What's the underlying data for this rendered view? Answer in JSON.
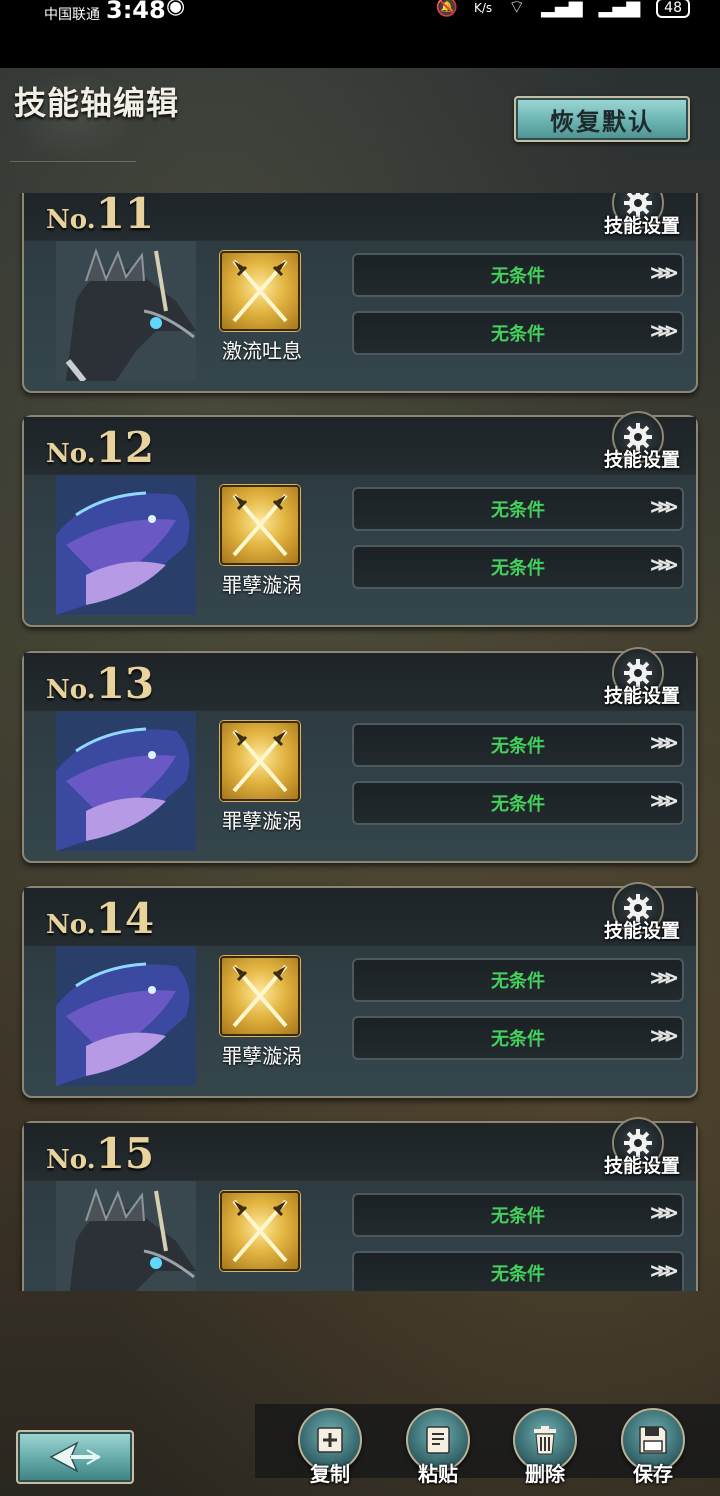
{
  "status_bar": {
    "carrier": "中国联通",
    "time": "3:48",
    "speed_unit": "K/s",
    "battery": "48"
  },
  "header": {
    "title": "技能轴编辑",
    "restore_label": "恢复默认"
  },
  "cards": [
    {
      "no_prefix": "No.",
      "number": "11",
      "settings_label": "技能设置",
      "skill_name": "激流吐息",
      "portrait": "dragon",
      "conditions": [
        "无条件",
        "无条件"
      ]
    },
    {
      "no_prefix": "No.",
      "number": "12",
      "settings_label": "技能设置",
      "skill_name": "罪孽漩涡",
      "portrait": "whale",
      "conditions": [
        "无条件",
        "无条件"
      ]
    },
    {
      "no_prefix": "No.",
      "number": "13",
      "settings_label": "技能设置",
      "skill_name": "罪孽漩涡",
      "portrait": "whale",
      "conditions": [
        "无条件",
        "无条件"
      ]
    },
    {
      "no_prefix": "No.",
      "number": "14",
      "settings_label": "技能设置",
      "skill_name": "罪孽漩涡",
      "portrait": "whale",
      "conditions": [
        "无条件",
        "无条件"
      ]
    },
    {
      "no_prefix": "No.",
      "number": "15",
      "settings_label": "技能设置",
      "skill_name": "",
      "portrait": "dragon",
      "conditions": [
        "无条件",
        "无条件"
      ]
    }
  ],
  "bottom_bar": {
    "copy_label": "复制",
    "paste_label": "粘贴",
    "delete_label": "删除",
    "save_label": "保存"
  },
  "colors": {
    "condition_text": "#44d05c",
    "number_gold": "#e8d39c",
    "button_teal": "#6fb8b6"
  },
  "icons": {
    "settings": "gear-icon",
    "skill": "crossed-swords-icon",
    "arrows": "triple-chevron-right-icon",
    "back": "back-arrow-icon",
    "copy": "copy-add-icon",
    "paste": "paste-icon",
    "delete": "trash-icon",
    "save": "floppy-disk-icon"
  }
}
